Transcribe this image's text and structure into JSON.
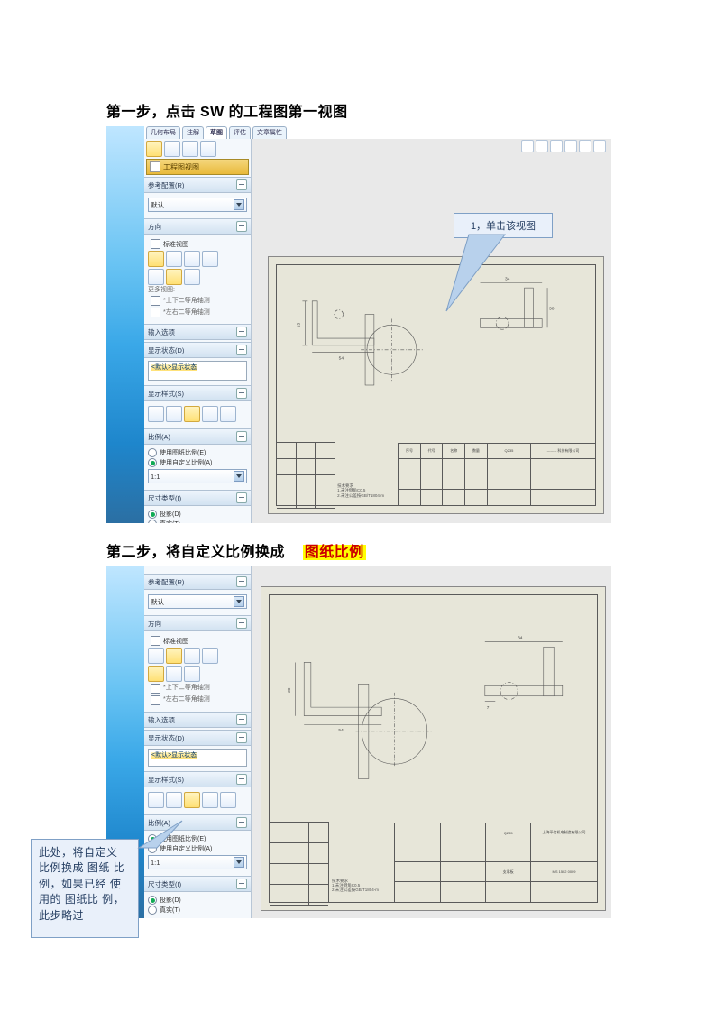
{
  "step1": {
    "heading": "第一步，点击 SW 的工程图第一视图",
    "callout": "1，单击该视图",
    "tabs": [
      "几何布局",
      "注解",
      "草图",
      "评估",
      "文章属性"
    ],
    "activeTab": "草图",
    "panelTitle": "工程图视图",
    "prop_reference": {
      "header": "参考配置(R)",
      "combo": "默认"
    },
    "prop_orient": {
      "header": "方向",
      "check": "标准视图"
    },
    "prop_import": {
      "header": "输入选项"
    },
    "prop_display": {
      "header": "显示状态(D)",
      "state": "<默认>显示状态"
    },
    "prop_displaystyle": {
      "header": "显示样式(S)"
    },
    "prop_scale": {
      "header": "比例(A)",
      "r1": "使用图纸比例(E)",
      "r2": "使用自定义比例(A)",
      "val": "1:1"
    },
    "prop_dimtype": {
      "header": "尺寸类型(I)",
      "r1": "投影(D)",
      "r2": "真实(T)"
    },
    "titleblock": {
      "partno": "Q235",
      "company": "-------- 科技有限公司",
      "labels": [
        "序号",
        "代号",
        "名称",
        "数量",
        "材料",
        "备注"
      ],
      "notes": [
        "技术要求",
        "1.未注倒角C0.5",
        "2.未注公差按GB/T1804-m"
      ]
    },
    "dims": {
      "d1": "54",
      "d2": "34",
      "d3": "30",
      "d4": "15"
    }
  },
  "step2": {
    "heading_pre": "第二步，将自定义比例换成",
    "heading_hl": "图纸比例",
    "callout": "此处，将自定义 比例换成 图纸 比例，如果已经 使用的 图纸比 例，此步略过",
    "prop_reference": {
      "header": "参考配置(R)",
      "combo": "默认"
    },
    "prop_orient": {
      "header": "方向",
      "check": "标准视图"
    },
    "prop_import": {
      "header": "输入选项"
    },
    "prop_display": {
      "header": "显示状态(D)",
      "state": "<默认>显示状态"
    },
    "prop_displaystyle": {
      "header": "显示样式(S)"
    },
    "prop_scale": {
      "header": "比例(A)",
      "r1": "使用图纸比例(E)",
      "r2": "使用自定义比例(A)",
      "val": "1:1"
    },
    "prop_dimtype": {
      "header": "尺寸类型(I)",
      "r1": "投影(D)",
      "r2": "真实(T)"
    },
    "titleblock": {
      "partno": "Q235",
      "company": "上海平信机电制造有限公司",
      "code": "MS 1502 0009",
      "name": "支承板"
    },
    "dims": {
      "d1": "54",
      "d2": "34",
      "d3": "7",
      "d4": "30"
    }
  }
}
